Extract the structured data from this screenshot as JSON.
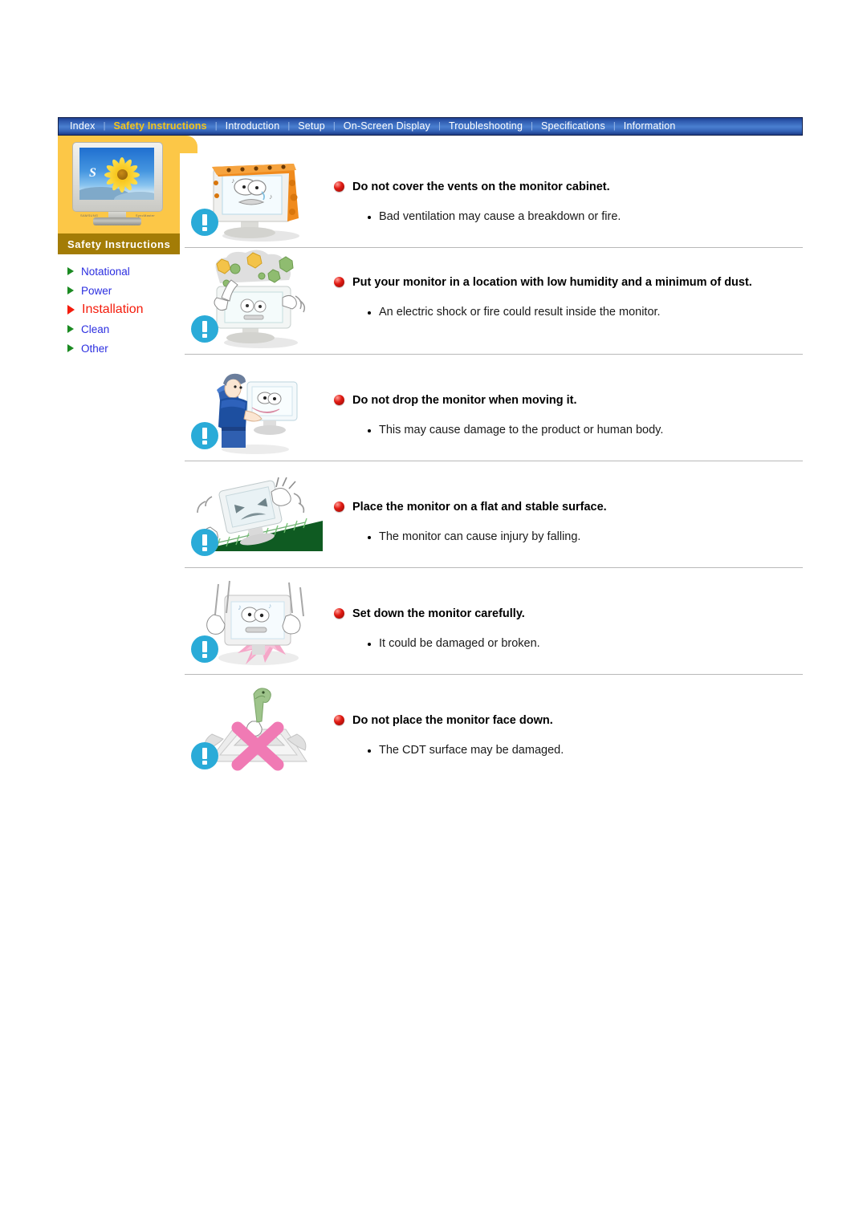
{
  "nav": {
    "items": [
      {
        "label": "Index",
        "active": false
      },
      {
        "label": "Safety Instructions",
        "active": true
      },
      {
        "label": "Introduction",
        "active": false
      },
      {
        "label": "Setup",
        "active": false
      },
      {
        "label": "On-Screen Display",
        "active": false
      },
      {
        "label": "Troubleshooting",
        "active": false
      },
      {
        "label": "Specifications",
        "active": false
      },
      {
        "label": "Information",
        "active": false
      }
    ],
    "separator": "|"
  },
  "sidebar": {
    "title": "Safety Instructions",
    "thumbnail_letter": "S",
    "thumbnail_brand_left": "SAMSUNG",
    "thumbnail_brand_right": "SyncMaster",
    "items": [
      {
        "label": "Notational",
        "active": false
      },
      {
        "label": "Power",
        "active": false
      },
      {
        "label": "Installation",
        "active": true
      },
      {
        "label": "Clean",
        "active": false
      },
      {
        "label": "Other",
        "active": false
      }
    ]
  },
  "sections": [
    {
      "icon": "monitor-covered-with-cloth-icon",
      "heading": "Do not cover the vents on the monitor cabinet.",
      "bullet": "Bad ventilation may cause a breakdown or fire."
    },
    {
      "icon": "monitor-in-dusty-environment-icon",
      "heading": "Put your monitor in a location with low humidity and a minimum of dust.",
      "bullet": "An electric shock or fire could result inside the monitor."
    },
    {
      "icon": "person-carrying-monitor-icon",
      "heading": "Do not drop the monitor when moving it.",
      "bullet": "This may cause damage to the product or human body."
    },
    {
      "icon": "monitor-on-slope-icon",
      "heading": "Place the monitor on a flat and stable surface.",
      "bullet": "The monitor can cause injury by falling."
    },
    {
      "icon": "monitor-dropped-hard-icon",
      "heading": "Set down the monitor carefully.",
      "bullet": "It could be damaged or broken."
    },
    {
      "icon": "monitor-face-down-crossed-icon",
      "heading": "Do not place the monitor face down.",
      "bullet": "The CDT surface may be damaged."
    }
  ],
  "colors": {
    "nav_background": "#2e59ad",
    "nav_active_text": "#f5c518",
    "sidebar_banner": "#fcc747",
    "sidebar_band": "#a37c06",
    "menu_link": "#2b2ee0",
    "menu_active": "#f41c0c",
    "menu_arrow": "#1b8a22",
    "heading_bullet": "#e01a12",
    "warning_badge": "#2aabd8",
    "divider": "#b9b9b9"
  }
}
